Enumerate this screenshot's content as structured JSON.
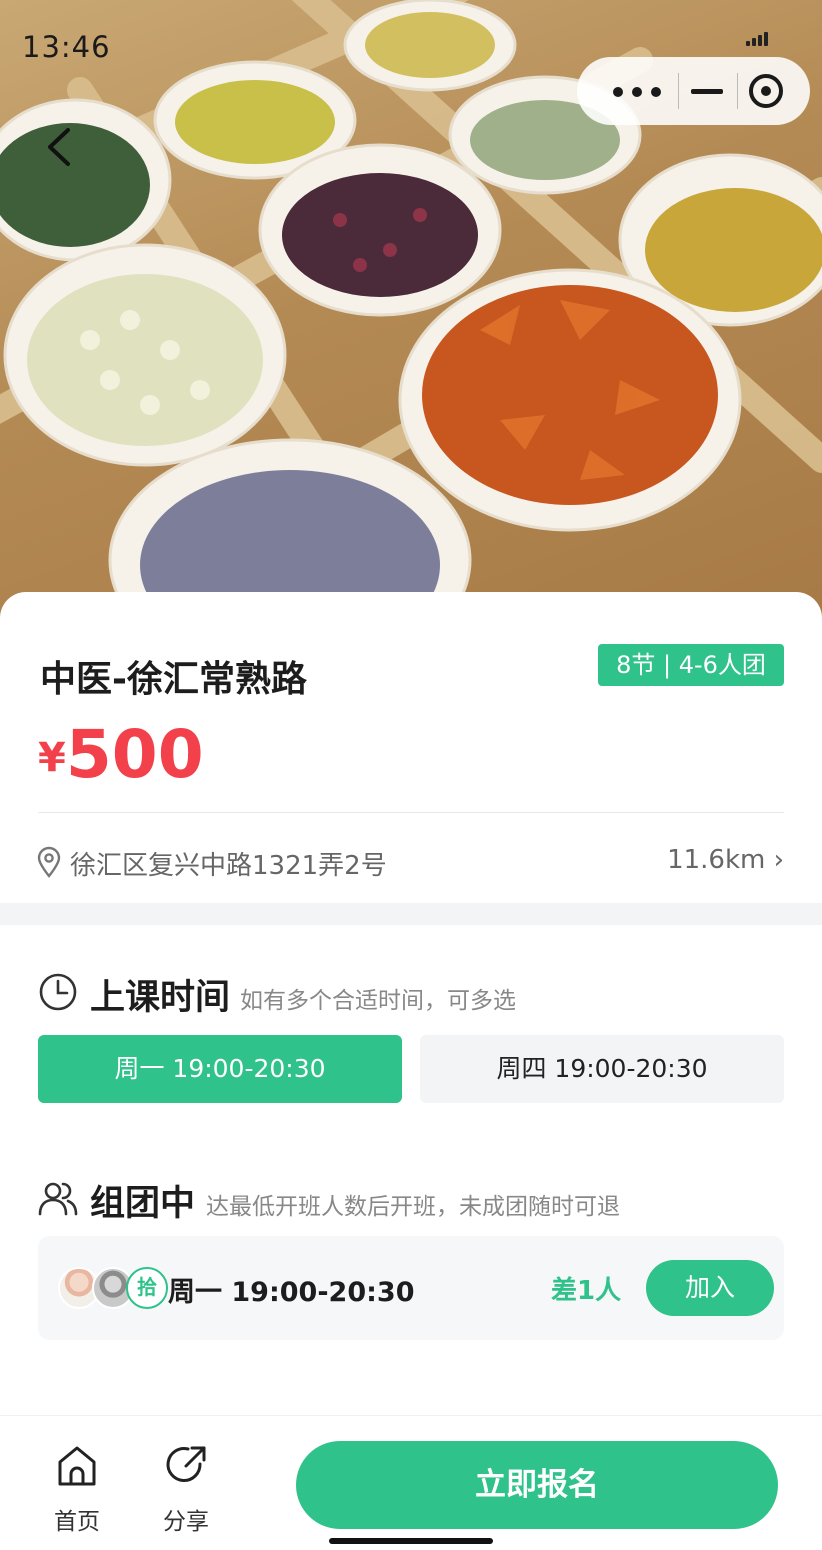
{
  "status_bar": {
    "time": "13:46"
  },
  "hero": {
    "image_description_icon": "dried-flower-tea-photo"
  },
  "course": {
    "title": "中医-徐汇常熟路",
    "tag": "8节 | 4-6人团",
    "currency": "¥",
    "price": "500",
    "address": "徐汇区复兴中路1321弄2号",
    "distance": "11.6km ›"
  },
  "schedule": {
    "title": "上课时间",
    "subtitle": "如有多个合适时间，可多选",
    "options": [
      {
        "label": "周一 19:00-20:30",
        "selected": true
      },
      {
        "label": "周四 19:00-20:30",
        "selected": false
      }
    ]
  },
  "group": {
    "title": "组团中",
    "subtitle": "达最低开班人数后开班，未成团随时可退",
    "item": {
      "avatar3_text": "拾",
      "time": "周一 19:00-20:30",
      "lack": "差1人",
      "join_label": "加入"
    }
  },
  "bottom": {
    "home_label": "首页",
    "share_label": "分享",
    "signup_label": "立即报名"
  },
  "colors": {
    "accent": "#2fc28a",
    "price": "#f2414b"
  }
}
